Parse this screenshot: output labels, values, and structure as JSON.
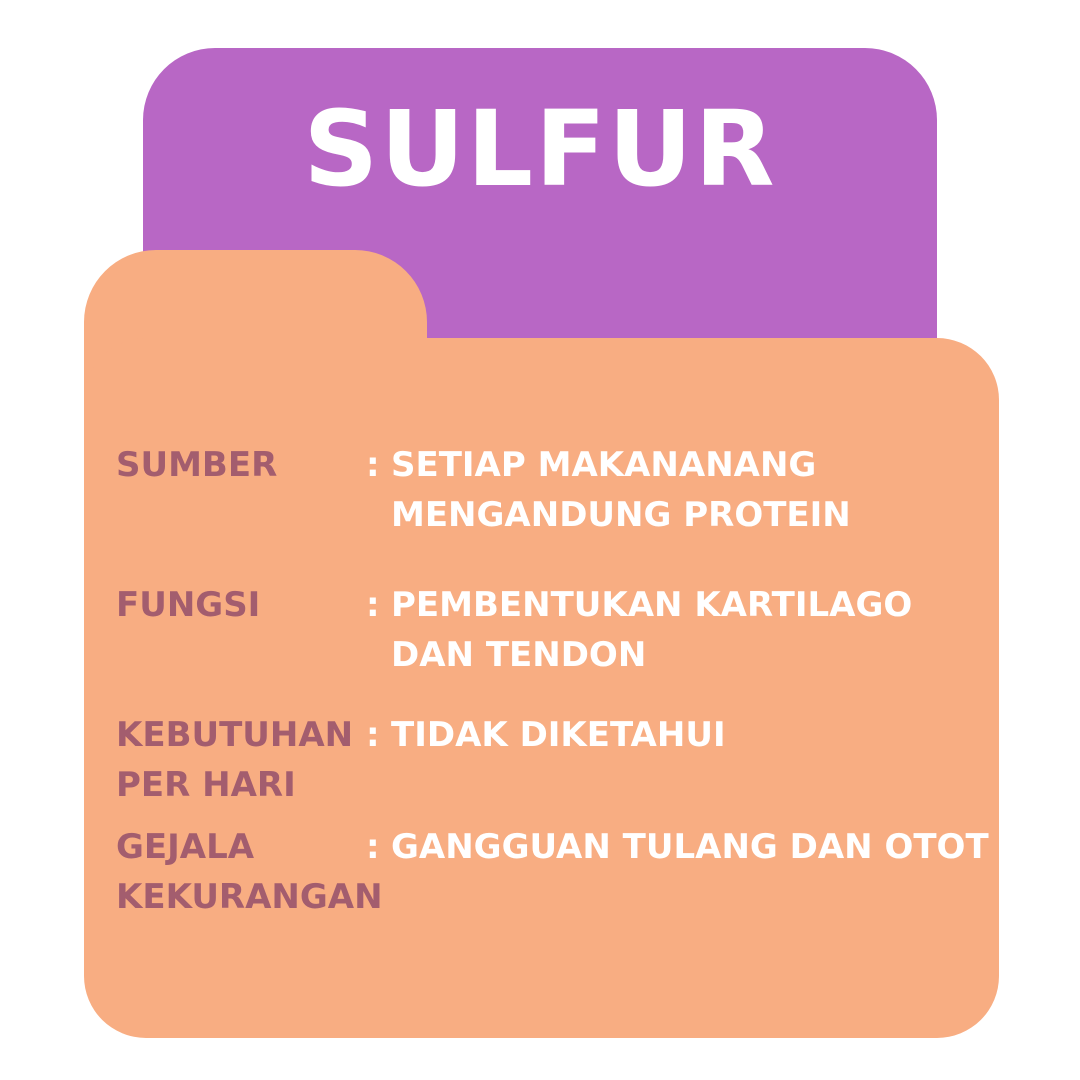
{
  "colors": {
    "purple": "#B867C5",
    "peach": "#F8AD82",
    "label_text": "#A35D6E",
    "value_text": "#FFFFFF",
    "title_text": "#FFFFFF"
  },
  "title": "SULFUR",
  "rows": [
    {
      "label": "SUMBER",
      "colon": ":",
      "value": "SETIAP MAKANANANG MENGANDUNG PROTEIN"
    },
    {
      "label": "FUNGSI",
      "colon": ":",
      "value": "PEMBENTUKAN KARTILAGO DAN TENDON"
    },
    {
      "label": "KEBUTUHAN PER HARI",
      "colon": ":",
      "value": "TIDAK DIKETAHUI"
    },
    {
      "label": "GEJALA KEKURANGAN",
      "colon": ":",
      "value": "GANGGUAN TULANG DAN OTOT"
    }
  ]
}
